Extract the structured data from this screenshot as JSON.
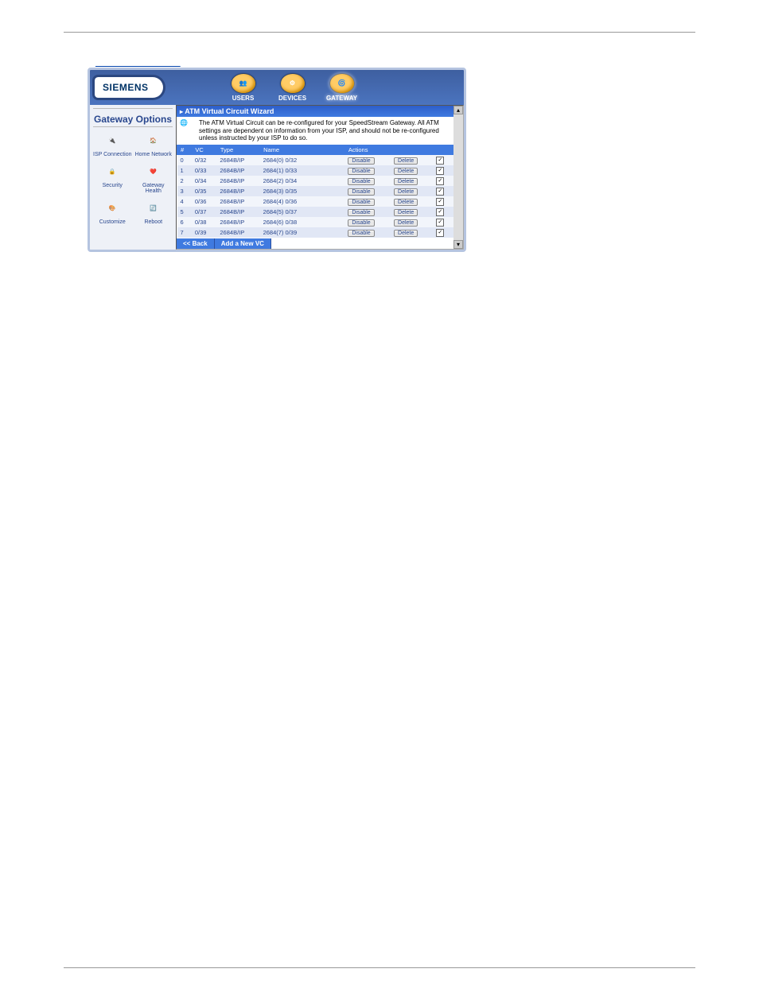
{
  "top_decoration_link": "",
  "logo": "SIEMENS",
  "topnav": [
    {
      "label": "USERS",
      "icon": "users-icon"
    },
    {
      "label": "DEVICES",
      "icon": "devices-icon"
    },
    {
      "label": "GATEWAY",
      "icon": "gateway-icon"
    }
  ],
  "sidebar": {
    "title": "Gateway Options",
    "items": [
      {
        "label": "ISP Connection",
        "name": "isp-connection"
      },
      {
        "label": "Home Network",
        "name": "home-network"
      },
      {
        "label": "Security",
        "name": "security"
      },
      {
        "label": "Gateway Health",
        "name": "gateway-health"
      },
      {
        "label": "Customize",
        "name": "customize"
      },
      {
        "label": "Reboot",
        "name": "reboot"
      }
    ]
  },
  "wizard": {
    "title": "ATM Virtual Circuit Wizard",
    "intro": "The ATM Virtual Circuit can be re-configured for your SpeedStream Gateway. All ATM settings are dependent on information from your ISP, and should not be re-configured unless instructed by your ISP to do so.",
    "headers": {
      "num": "#",
      "vc": "VC",
      "type": "Type",
      "name": "Name",
      "actions": "Actions"
    },
    "rows": [
      {
        "num": "0",
        "vc": "0/32",
        "type": "2684B/IP",
        "name": "2684(0) 0/32"
      },
      {
        "num": "1",
        "vc": "0/33",
        "type": "2684B/IP",
        "name": "2684(1) 0/33"
      },
      {
        "num": "2",
        "vc": "0/34",
        "type": "2684B/IP",
        "name": "2684(2) 0/34"
      },
      {
        "num": "3",
        "vc": "0/35",
        "type": "2684B/IP",
        "name": "2684(3) 0/35"
      },
      {
        "num": "4",
        "vc": "0/36",
        "type": "2684B/IP",
        "name": "2684(4) 0/36"
      },
      {
        "num": "5",
        "vc": "0/37",
        "type": "2684B/IP",
        "name": "2684(5) 0/37"
      },
      {
        "num": "6",
        "vc": "0/38",
        "type": "2684B/IP",
        "name": "2684(6) 0/38"
      },
      {
        "num": "7",
        "vc": "0/39",
        "type": "2684B/IP",
        "name": "2684(7) 0/39"
      }
    ],
    "action_disable": "Disable",
    "action_delete": "Delete",
    "back": "<< Back",
    "add": "Add a New VC"
  }
}
